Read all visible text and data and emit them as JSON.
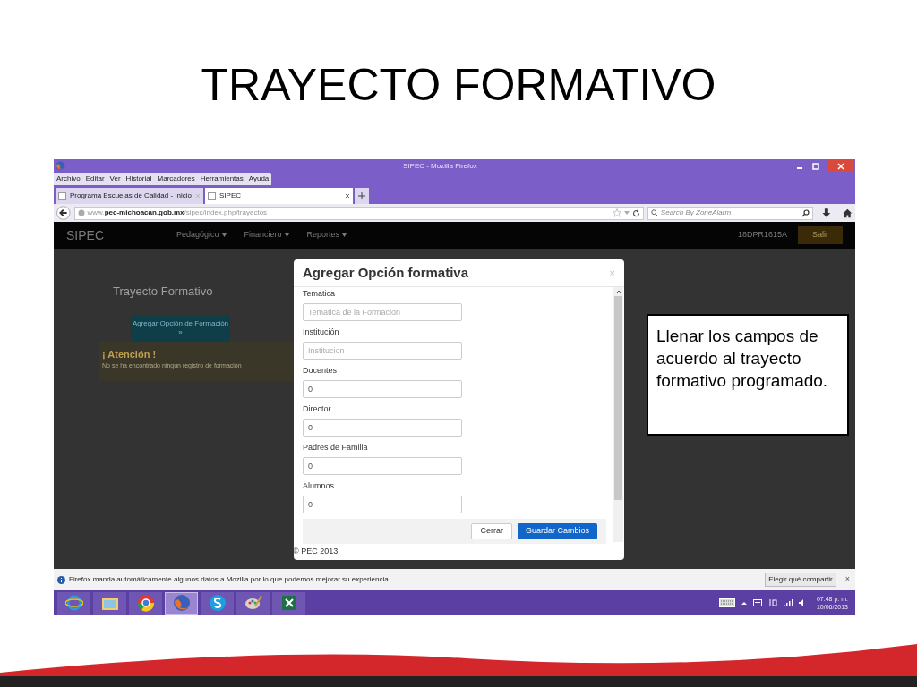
{
  "slide": {
    "title": "TRAYECTO FORMATIVO",
    "callout": "Llenar los campos de acuerdo al trayecto formativo programado."
  },
  "window": {
    "title": "SIPEC - Mozilla Firefox"
  },
  "menu": [
    "Archivo",
    "Editar",
    "Ver",
    "Historial",
    "Marcadores",
    "Herramientas",
    "Ayuda"
  ],
  "tabs": [
    {
      "label": "Programa Escuelas de Calidad - Inicio",
      "selected": false
    },
    {
      "label": "SIPEC",
      "selected": true
    }
  ],
  "address": {
    "host": "www.",
    "domain": "pec-michoacan.gob.mx",
    "path": "/sipec/index.php/trayectos"
  },
  "search": {
    "placeholder": "Search By ZoneAlarm"
  },
  "site_nav": {
    "brand": "SIPEC",
    "items": [
      "Pedagógico",
      "Financiero",
      "Reportes"
    ],
    "user": "18DPR1615A",
    "logout": "Salir"
  },
  "page": {
    "heading": "Trayecto Formativo",
    "add_button": "Agregar Opción de Formación »",
    "alert_title": "¡ Atención !",
    "alert_text": "No se ha encontrado ningún registro de formación",
    "footer": "© PEC 2013"
  },
  "modal": {
    "title": "Agregar Opción formativa",
    "close": "×",
    "fields": [
      {
        "label": "Tematica",
        "placeholder": "Tematica de la Formacion"
      },
      {
        "label": "Institución",
        "placeholder": "Institucion"
      },
      {
        "label": "Docentes",
        "value": "0"
      },
      {
        "label": "Director",
        "value": "0"
      },
      {
        "label": "Padres de Familia",
        "value": "0"
      },
      {
        "label": "Alumnos",
        "value": "0"
      }
    ],
    "buttons": [
      {
        "label": "Cerrar",
        "kind": "secondary"
      },
      {
        "label": "Guardar Cambios",
        "kind": "primary"
      }
    ]
  },
  "notification": {
    "text": "Firefox manda automáticamente algunos datos a Mozilla por lo que podemos mejorar su experiencia.",
    "button": "Elegir qué compartir",
    "close": "×"
  },
  "taskbar": {
    "apps": [
      {
        "kind": "ie",
        "selected": false
      },
      {
        "kind": "folder",
        "selected": false
      },
      {
        "kind": "chrome",
        "selected": false
      },
      {
        "kind": "firefox",
        "selected": true
      },
      {
        "kind": "skype",
        "selected": false
      },
      {
        "kind": "paint",
        "selected": false
      },
      {
        "kind": "excel",
        "selected": false
      }
    ],
    "time": "07:48 p. m.",
    "date": "10/06/2013"
  }
}
